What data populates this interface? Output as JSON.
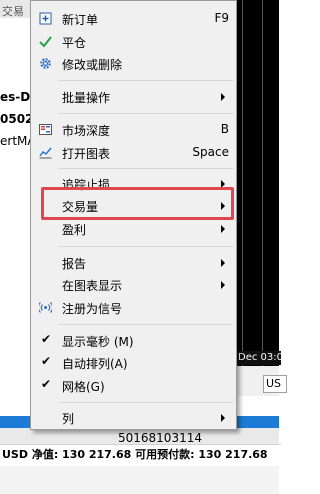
{
  "background": {
    "tab_label": "交易",
    "side_texts": [
      "es-De",
      "0502:",
      "ertMA"
    ],
    "chart_date": "Dec 03:00",
    "chart_tab": "US",
    "rows": [
      "50193205016",
      "50168103114"
    ],
    "status_bar": "USD  净值: 130 217.68    可用预付款: 130 217.68"
  },
  "menu": {
    "items": [
      {
        "label": "新订单",
        "shortcut": "F9",
        "icon": "new-order-icon"
      },
      {
        "label": "平仓",
        "icon": "check-icon"
      },
      {
        "label": "修改或删除",
        "icon": "gear-icon"
      },
      {
        "label": "批量操作",
        "submenu": true
      },
      {
        "label": "市场深度",
        "shortcut": "B",
        "icon": "market-depth-icon"
      },
      {
        "label": "打开图表",
        "shortcut": "Space",
        "icon": "chart-icon"
      },
      {
        "label": "追踪止损",
        "submenu": true
      },
      {
        "label": "交易量",
        "submenu": true
      },
      {
        "label": "盈利",
        "submenu": true
      },
      {
        "label": "报告",
        "submenu": true
      },
      {
        "label": "在图表显示",
        "submenu": true
      },
      {
        "label": "注册为信号",
        "icon": "signal-icon"
      },
      {
        "label": "显示毫秒 (M)",
        "checked": true
      },
      {
        "label": "自动排列(A)",
        "checked": true
      },
      {
        "label": "网格(G)",
        "checked": true
      },
      {
        "label": "列",
        "submenu": true
      }
    ],
    "highlighted_item": "交易量",
    "highlight_color": "#e0474c"
  }
}
